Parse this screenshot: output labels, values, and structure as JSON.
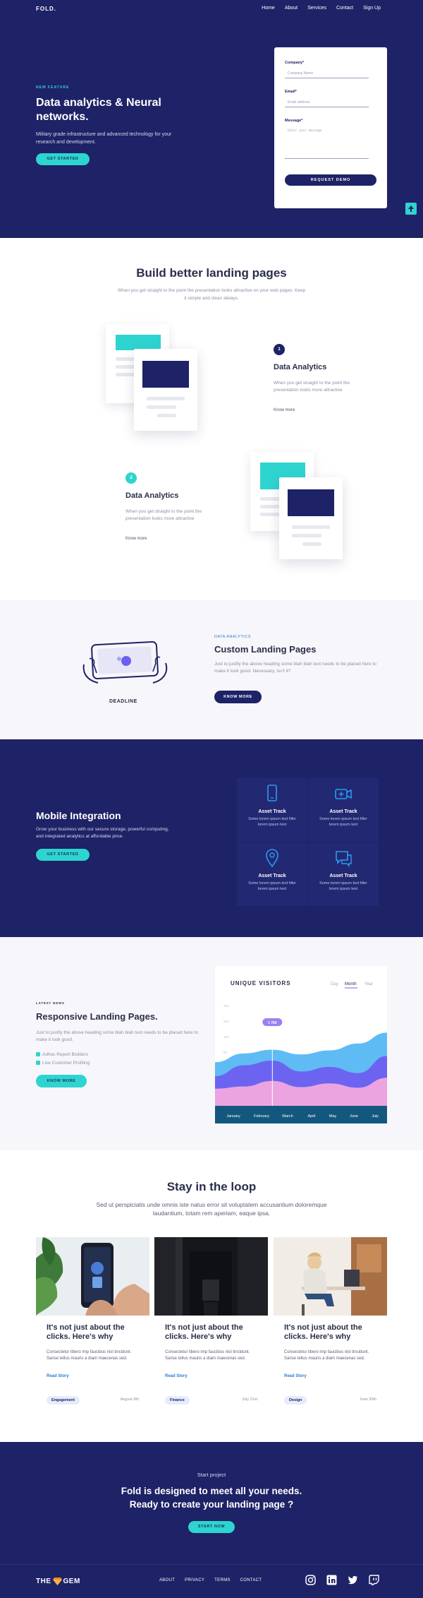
{
  "brand": {
    "logo": "FOLD."
  },
  "nav": [
    "Home",
    "About",
    "Services",
    "Contact",
    "Sign Up"
  ],
  "hero": {
    "eyebrow": "NEW FEATURE",
    "title": "Data analytics & Neural networks.",
    "subtitle": "Military grade infrastructure and advanced technology for your research and development.",
    "cta": "GET STARTED"
  },
  "form": {
    "company_label": "Company*",
    "company_placeholder": "Company Name",
    "email_label": "Email*",
    "email_placeholder": "Email address",
    "message_label": "Message*",
    "message_placeholder": "Enter your message",
    "submit": "REQUEST DEMO"
  },
  "features": {
    "title": "Build better landing pages",
    "subtitle": "When you get straight to the point the presentation looks attractive on your web pages. Keep it simple and clean always.",
    "items": [
      {
        "num": "1",
        "title": "Data Analytics",
        "text": "When you get straight to the point the presentation looks more attractive",
        "link": "Know more"
      },
      {
        "num": "2",
        "title": "Data Analytics",
        "text": "When you get straight to the point the presentation looks more attractive",
        "link": "Know more"
      }
    ]
  },
  "deadline": {
    "label": "DEADLINE",
    "eyebrow": "DATA ANALYTICS",
    "title": "Custom Landing Pages",
    "subtitle": "Just to justify the above heading some blah blah text needs to be placed here to make it look good. Necessary, isn't it?",
    "cta": "KNOW MORE"
  },
  "mobile": {
    "title": "Mobile Integration",
    "subtitle": "Grow your business with our secure storage, powerful computing, and integrated analytics at affordable price.",
    "cta": "GET STARTED",
    "tiles": [
      {
        "icon": "smartphone-icon",
        "title": "Asset Track",
        "text": "Some lorem ipsum text filler lorem ipsum text"
      },
      {
        "icon": "video-camera-icon",
        "title": "Asset Track",
        "text": "Some lorem ipsum text filler lorem ipsum text"
      },
      {
        "icon": "map-pin-icon",
        "title": "Asset Track",
        "text": "Some lorem ipsum text filler lorem ipsum text"
      },
      {
        "icon": "chat-bubbles-icon",
        "title": "Asset Track",
        "text": "Some lorem ipsum text filler lorem ipsum text"
      }
    ]
  },
  "responsive": {
    "eyebrow": "LATEST NEWS",
    "title": "Responsive Landing Pages.",
    "subtitle": "Just to justify the above heading some blah blah text needs to be placed here to make it look good.",
    "checks": [
      "Adhoc Report Builders",
      "Live Customer Profiling"
    ],
    "cta": "KNOW MORE"
  },
  "chart_data": {
    "type": "area",
    "title": "UNIQUE VISITORS",
    "tabs": [
      "Day",
      "Month",
      "Year"
    ],
    "active_tab": "Month",
    "categories": [
      "January",
      "February",
      "March",
      "April",
      "May",
      "June",
      "July"
    ],
    "y_ticks": [
      "300",
      "200",
      "100",
      "50"
    ],
    "ylim": [
      0,
      340
    ],
    "tooltip": {
      "category": "March",
      "label": "1 784"
    },
    "series": [
      {
        "color": "#56b7f2",
        "values": [
          140,
          168,
          180,
          165,
          178,
          200,
          235
        ]
      },
      {
        "color": "#6d5ff0",
        "values": [
          95,
          130,
          145,
          110,
          125,
          105,
          160
        ]
      },
      {
        "color": "#f3a8de",
        "values": [
          55,
          62,
          80,
          60,
          72,
          58,
          90
        ]
      }
    ]
  },
  "blog": {
    "title": "Stay in the loop",
    "subtitle": "Sed ut perspiciatis unde omnis iste natus error sit voluptatem accusantium doloremque laudantium, totam rem aperiam, eaque ipsa.",
    "cards": [
      {
        "title": "It's not just about the clicks. Here's why",
        "text": "Consectetur libero imp faucibus nisl tincidunt. Sanse tellus mauris a diam maecenas sed.",
        "link": "Read Story",
        "tag": "Engagement",
        "date": "August 9th"
      },
      {
        "title": "It's not just about the clicks. Here's why",
        "text": "Consectetur libero imp faucibus nisl tincidunt. Sanse tellus mauris a diam maecenas sed.",
        "link": "Read Story",
        "tag": "Finance",
        "date": "July 21st"
      },
      {
        "title": "It's not just about the clicks. Here's why",
        "text": "Consectetur libero imp faucibus nisl tincidunt. Sanse tellus mauris a diam maecenas sed.",
        "link": "Read Story",
        "tag": "Design",
        "date": "June 30th"
      }
    ]
  },
  "cta": {
    "eyebrow": "Start project",
    "title": "Fold is designed to meet all your needs. Ready to create your landing page ?",
    "button": "START NOW"
  },
  "footer": {
    "logo_left": "THE",
    "logo_right": "GEM",
    "nav": [
      "ABOUT",
      "PRIVACY",
      "TERMS",
      "CONTACT"
    ],
    "social": [
      "instagram-icon",
      "linkedin-icon",
      "twitter-icon",
      "twitch-icon"
    ]
  },
  "colors": {
    "navy": "#1e2266",
    "teal": "#2ed4cf",
    "link_blue": "#2a7bd6"
  }
}
